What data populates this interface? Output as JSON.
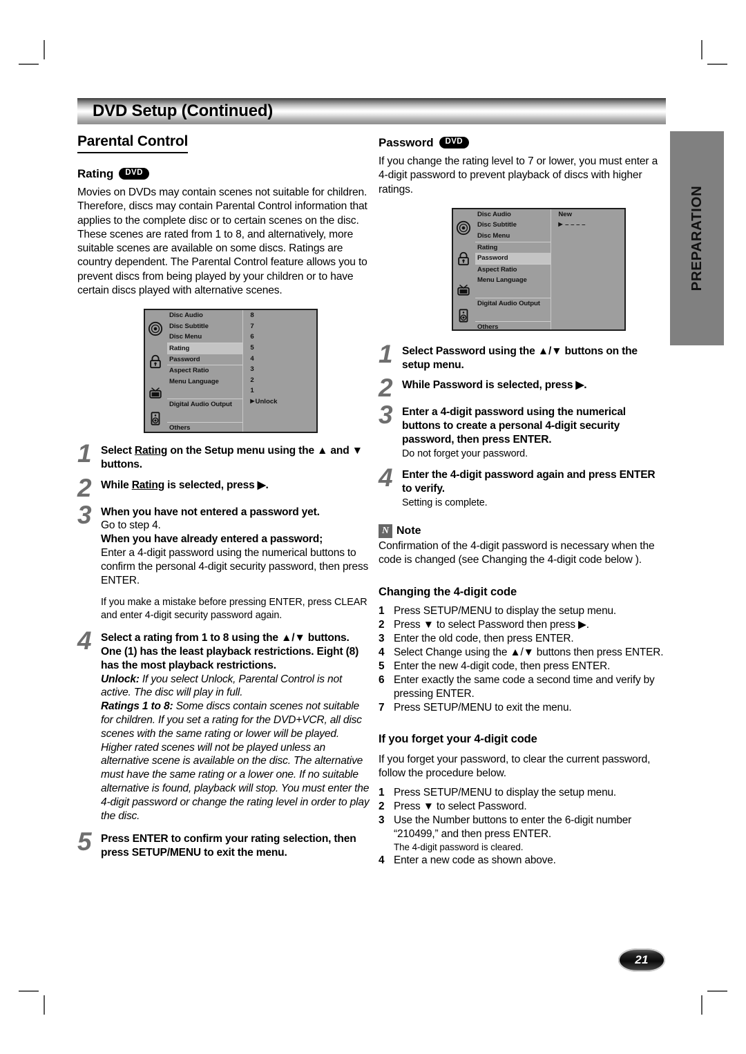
{
  "page": {
    "header_title": "DVD Setup (Continued)",
    "side_tab": "PREPARATION",
    "page_number": "21"
  },
  "left": {
    "section_title": "Parental Control",
    "rating_heading": "Rating",
    "rating_badge": "DVD",
    "intro": "Movies on DVDs may contain scenes not suitable for children. Therefore, discs may contain Parental Control information that applies to the complete disc or to certain scenes on the disc. These scenes are rated from 1 to 8, and alternatively, more suitable scenes are available on some discs. Ratings are country dependent. The Parental Control feature allows you to prevent discs from being played by your children or to have certain discs played with alternative scenes.",
    "osd": {
      "rows": [
        "Disc Audio",
        "Disc Subtitle",
        "Disc Menu",
        "Rating",
        "Password",
        "Aspect Ratio",
        "Menu Language",
        "Digital Audio Output",
        "Others"
      ],
      "highlighted_row": "Rating",
      "values": [
        "8",
        "7",
        "6",
        "5",
        "4",
        "3",
        "2",
        "1",
        "Unlock"
      ],
      "selected_value": "Unlock",
      "icons": [
        "disc-icon",
        "lock-icon",
        "tv-icon",
        "speaker-icon"
      ]
    },
    "steps": {
      "s1_a": "Select ",
      "s1_b": "Rating",
      "s1_c": " on the Setup menu using the ▲ and ▼ buttons.",
      "s2_a": "While ",
      "s2_b": "Rating",
      "s2_c": " is selected, press ▶.",
      "s3_line1": "When you have not entered a password yet.",
      "s3_line2": "Go to step 4.",
      "s3_line3": "When you have already entered a password;",
      "s3_line4": "Enter a 4-digit password using the numerical buttons to confirm the personal 4-digit security password, then press ENTER.",
      "s3_line5": "If you make a mistake before pressing ENTER, press CLEAR and enter 4-digit security password again.",
      "s4_bold": "Select a rating from 1 to 8 using the ▲/▼ buttons. One (1) has the least playback restrictions. Eight (8) has the most playback restrictions.",
      "s4_unlock_label": "Unlock:",
      "s4_unlock_text": " If you select Unlock, Parental Control is not active. The disc will play in full.",
      "s4_ratings_label": "Ratings 1 to 8:",
      "s4_ratings_text": " Some discs contain scenes not suitable for children. If you set a rating for the DVD+VCR, all disc scenes with the same rating or lower will be played. Higher rated scenes will not be played unless an alternative scene is available on the disc. The alternative must have the same rating or a lower one. If no suitable alternative is found, playback will stop. You must enter the 4-digit password or change the rating level in order to play the disc.",
      "s5": "Press ENTER to confirm your rating selection, then press SETUP/MENU to exit the menu."
    }
  },
  "right": {
    "password_heading": "Password",
    "password_badge": "DVD",
    "password_intro": "If you change the rating level to 7 or lower, you must enter a 4-digit password to prevent playback of discs with higher ratings.",
    "osd": {
      "rows": [
        "Disc Audio",
        "Disc Subtitle",
        "Disc Menu",
        "Rating",
        "Password",
        "Aspect Ratio",
        "Menu Language",
        "Digital Audio Output",
        "Others"
      ],
      "highlighted_row": "Password",
      "value_new": "New",
      "value_dashes": "– – – –",
      "icons": [
        "disc-icon",
        "lock-icon",
        "tv-icon",
        "speaker-icon"
      ]
    },
    "steps": {
      "s1": "Select Password using the ▲/▼ buttons on the setup menu.",
      "s2": "While Password is selected, press ▶.",
      "s3_bold": "Enter a 4-digit password using the numerical buttons to create a personal 4-digit security password, then press ENTER.",
      "s3_note": "Do not forget your password.",
      "s4_bold": "Enter the 4-digit password again and press ENTER to verify.",
      "s4_note": "Setting is complete."
    },
    "note": {
      "icon_letter": "N",
      "title": "Note",
      "text": "Confirmation of the 4-digit password is necessary when the code is changed (see Changing the 4-digit code below )."
    },
    "changing": {
      "title": "Changing the 4-digit code",
      "items": [
        "Press SETUP/MENU to display the setup menu.",
        "Press ▼ to select Password then press ▶.",
        "Enter the old code, then press ENTER.",
        "Select Change using the ▲/▼ buttons then press ENTER.",
        "Enter the new 4-digit code, then press ENTER.",
        "Enter exactly the same code a second time and verify by pressing ENTER.",
        "Press SETUP/MENU to exit the menu."
      ]
    },
    "forgot": {
      "title": "If you forget your 4-digit code",
      "intro": "If you forget your password, to clear the current password, follow the procedure below.",
      "items": [
        "Press SETUP/MENU to display the setup menu.",
        "Press ▼ to select Password.",
        "Use the Number buttons to enter the 6-digit number “210499,” and then press ENTER.",
        "Enter a new code as shown above."
      ],
      "item3_sub": "The 4-digit password is cleared."
    }
  }
}
